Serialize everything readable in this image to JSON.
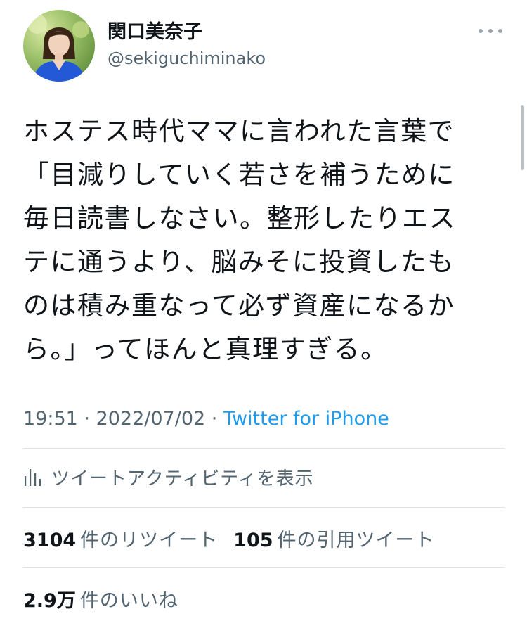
{
  "author": {
    "display_name": "関口美奈子",
    "handle": "@sekiguchiminako"
  },
  "tweet": {
    "text": "ホステス時代ママに言われた言葉で\n「目減りしていく若さを補うために\n毎日読書しなさい。整形したりエス\nテに通うより、脳みそに投資したも\nのは積み重なって必ず資産になるか\nら。」ってほんと真理すぎる。",
    "time": "19:51",
    "separator": " · ",
    "date": "2022/07/02",
    "source": "Twitter for iPhone"
  },
  "activity": {
    "label": "ツイートアクティビティを表示"
  },
  "stats": {
    "retweets_count": "3104",
    "retweets_label": "件のリツイート",
    "quotes_count": "105",
    "quotes_label": "件の引用ツイート",
    "likes_count": "2.9万",
    "likes_label": "件のいいね"
  },
  "icons": {
    "more": "more-horizontal-icon",
    "activity": "bar-chart-icon"
  },
  "colors": {
    "link": "#1d9bf0",
    "secondary_text": "#536471",
    "primary_text": "#0f1419"
  }
}
